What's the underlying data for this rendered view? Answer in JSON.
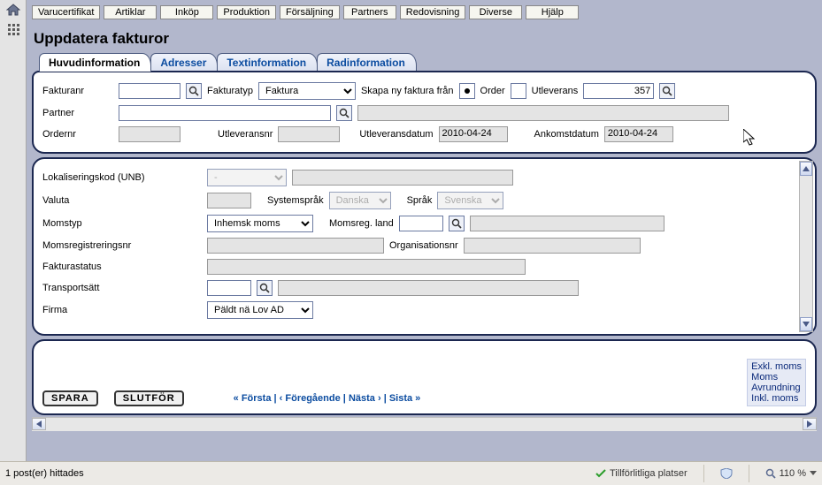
{
  "menu": [
    "Varucertifikat",
    "Artiklar",
    "Inköp",
    "Produktion",
    "Försäljning",
    "Partners",
    "Redovisning",
    "Diverse",
    "Hjälp"
  ],
  "page": {
    "title": "Uppdatera fakturor"
  },
  "tabs": [
    "Huvudinformation",
    "Adresser",
    "Textinformation",
    "Radinformation"
  ],
  "top": {
    "fakturanr_label": "Fakturanr",
    "fakturanr_value": "",
    "fakturatyp_label": "Fakturatyp",
    "fakturatyp_value": "Faktura",
    "skapa_label": "Skapa ny faktura från",
    "order_label": "Order",
    "utleverans_label": "Utleverans",
    "utleverans_value": "357",
    "partner_label": "Partner",
    "partner_value": "",
    "partner_desc": "",
    "ordernr_label": "Ordernr",
    "ordernr_value": "",
    "utleveransnr_label": "Utleveransnr",
    "utleveransnr_value": "",
    "utleveransdatum_label": "Utleveransdatum",
    "utleveransdatum_value": "2010-04-24",
    "ankomstdatum_label": "Ankomstdatum",
    "ankomstdatum_value": "2010-04-24"
  },
  "mid": {
    "lokalisering_label": "Lokaliseringskod (UNB)",
    "lokalisering_value": "-",
    "valuta_label": "Valuta",
    "systemsprak_label": "Systemspråk",
    "systemsprak_value": "Danska",
    "sprak_label": "Språk",
    "sprak_value": "Svenska",
    "momstyp_label": "Momstyp",
    "momstyp_value": "Inhemsk moms",
    "momsreg_land_label": "Momsreg. land",
    "momsreg_land_value": "",
    "momsregnr_label": "Momsregistreringsnr",
    "orgnr_label": "Organisationsnr",
    "fakturastatus_label": "Fakturastatus",
    "transport_label": "Transportsätt",
    "firma_label": "Firma",
    "firma_value": "Päldt nä Lov AD"
  },
  "footer": {
    "spara": "SPARA",
    "slutfor": "SLUTFÖR",
    "pager_first": "« Första",
    "pager_prev": "‹ Föregående",
    "pager_next": "Nästa ›",
    "pager_last": "Sista »",
    "totals": [
      "Exkl. moms",
      "Moms",
      "Avrundning",
      "Inkl. moms"
    ]
  },
  "status": {
    "left": "1 post(er) hittades",
    "trusted": "Tillförlitliga platser",
    "zoom": "110 %"
  }
}
